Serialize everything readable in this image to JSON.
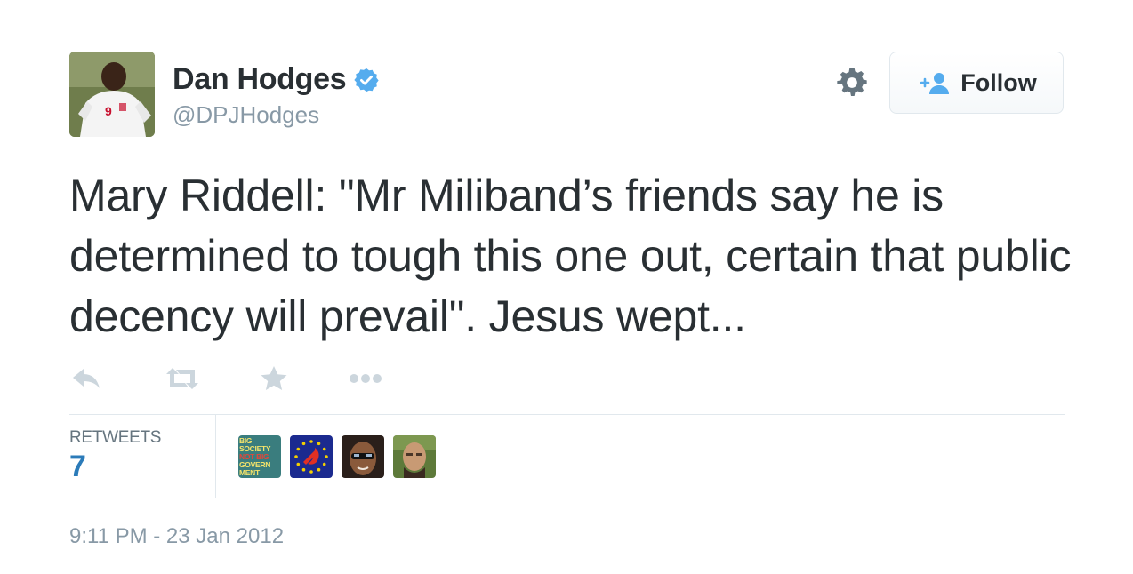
{
  "user": {
    "name": "Dan Hodges",
    "handle": "@DPJHodges",
    "verified": true,
    "avatar_icon": "user-avatar-footballer"
  },
  "follow": {
    "label": "Follow",
    "icon": "add-user-icon"
  },
  "tweet": {
    "text": "Mary Riddell: \"Mr Miliband’s friends say he is determined to tough this one out, certain that public decency will prevail\". Jesus wept..."
  },
  "actions": [
    {
      "name": "reply",
      "icon": "reply-icon"
    },
    {
      "name": "retweet",
      "icon": "retweet-icon"
    },
    {
      "name": "favorite",
      "icon": "star-icon"
    },
    {
      "name": "more",
      "icon": "more-icon"
    }
  ],
  "stats": {
    "retweets_label": "RETWEETS",
    "retweets_count": "7"
  },
  "retweeter_avatars": [
    {
      "icon": "big-society-avatar",
      "text": "BIG SOCIETY NOT BIG GOVERNMENT"
    },
    {
      "icon": "eu-hammer-sickle-avatar"
    },
    {
      "icon": "sunglasses-man-avatar"
    },
    {
      "icon": "bald-man-avatar"
    }
  ],
  "timestamp": "9:11 PM - 23 Jan 2012",
  "colors": {
    "text": "#292f33",
    "muted": "#8899a6",
    "link": "#2b7bb9",
    "verified": "#55acee",
    "border": "#e1e8ed"
  }
}
